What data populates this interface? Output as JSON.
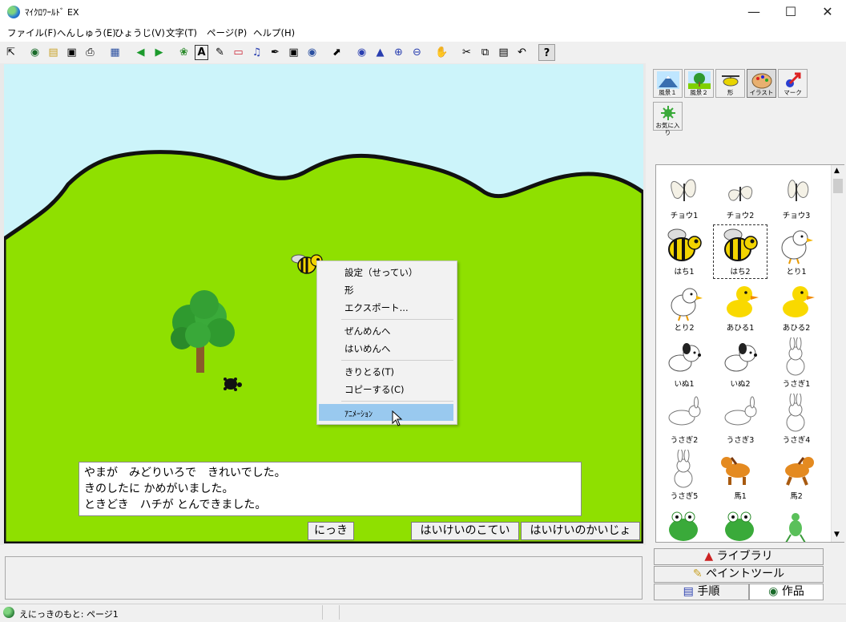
{
  "window": {
    "title": "ﾏｲｸﾛﾜｰﾙﾄﾞ EX"
  },
  "menu": [
    "ファイル(F)",
    "へんしゅう(E)",
    "ひょうじ(V)",
    "文字(T)",
    "ページ(P)",
    "ヘルプ(H)"
  ],
  "toolbar": {
    "icons": [
      "select-arrow-icon",
      "world-icon",
      "open-folder-icon",
      "save-icon",
      "print-icon",
      "panel-icon",
      "prev-page-icon",
      "next-page-icon",
      "plant-icon",
      "text-icon",
      "paint-icon",
      "eraser-icon",
      "music-icon",
      "pen-icon",
      "movie-icon",
      "web-icon",
      "pointer-icon",
      "eye-icon",
      "stamp-icon",
      "zoom-in-icon",
      "zoom-out-icon",
      "hand-stop-icon",
      "cut-icon",
      "copy-icon",
      "paste-icon",
      "undo-icon",
      "help-icon"
    ]
  },
  "context_menu": {
    "items": [
      "設定（せってい）",
      "形",
      "エクスポート...",
      "ぜんめんへ",
      "はいめんへ",
      "きりとる(T)",
      "コピーする(C)",
      "ｱﾆﾒｰｼｮﾝ"
    ],
    "highlighted": "ｱﾆﾒｰｼｮﾝ"
  },
  "diary": {
    "lines": [
      "やまが　みどりいろで　きれいでした。",
      "きのしたに かめがいました。",
      "ときどき　ハチが とんできました。"
    ]
  },
  "canvas_buttons": {
    "diary": "にっき",
    "bg_fix": "はいけいのこてい",
    "bg_release": "はいけいのかいじょ"
  },
  "categories": [
    {
      "label": "風景１",
      "icon": "mountain-icon"
    },
    {
      "label": "風景２",
      "icon": "tree-scene-icon"
    },
    {
      "label": "形",
      "icon": "helicopter-icon"
    },
    {
      "label": "イラスト",
      "icon": "palette-icon",
      "selected": true
    },
    {
      "label": "マーク",
      "icon": "arrow-mark-icon"
    }
  ],
  "favorite": {
    "label": "お気に入り"
  },
  "library_items": [
    {
      "label": "チョウ1",
      "kind": "butterfly"
    },
    {
      "label": "チョウ2",
      "kind": "butterfly"
    },
    {
      "label": "チョウ3",
      "kind": "butterfly"
    },
    {
      "label": "はち1",
      "kind": "bee"
    },
    {
      "label": "はち2",
      "kind": "bee",
      "selected": true
    },
    {
      "label": "とり1",
      "kind": "bird"
    },
    {
      "label": "とり2",
      "kind": "bird"
    },
    {
      "label": "あひる1",
      "kind": "duck"
    },
    {
      "label": "あひる2",
      "kind": "duck"
    },
    {
      "label": "いぬ1",
      "kind": "dog"
    },
    {
      "label": "いぬ2",
      "kind": "dog"
    },
    {
      "label": "うさぎ1",
      "kind": "rabbit"
    },
    {
      "label": "うさぎ2",
      "kind": "rabbit"
    },
    {
      "label": "うさぎ3",
      "kind": "rabbit"
    },
    {
      "label": "うさぎ4",
      "kind": "rabbit"
    },
    {
      "label": "うさぎ5",
      "kind": "rabbit"
    },
    {
      "label": "馬1",
      "kind": "horse"
    },
    {
      "label": "馬2",
      "kind": "horse"
    },
    {
      "label": "",
      "kind": "frog"
    },
    {
      "label": "",
      "kind": "frog"
    },
    {
      "label": "",
      "kind": "frog"
    }
  ],
  "panel_tabs": {
    "library": "ライブラリ",
    "paint": "ペイントツール",
    "steps": "手順",
    "works": "作品"
  },
  "status": {
    "text": "えにっきのもと: ページ1"
  }
}
